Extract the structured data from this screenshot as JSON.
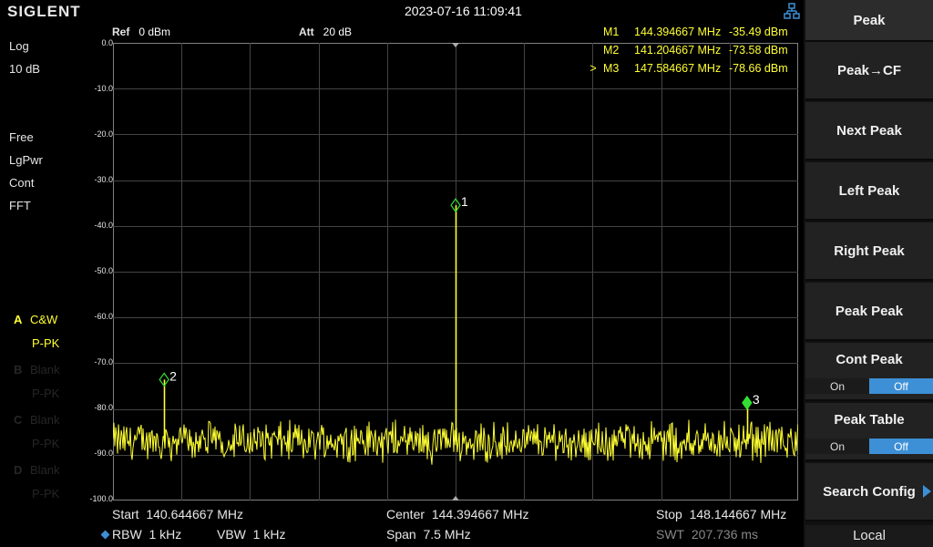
{
  "header": {
    "logo": "SIGLENT",
    "datetime": "2023-07-16 11:09:41",
    "ref_label": "Ref",
    "ref_value": "0 dBm",
    "att_label": "Att",
    "att_value": "20 dB"
  },
  "left_panel": {
    "scale_type": "Log",
    "scale_div": "10 dB",
    "sweep": "Free",
    "avg_type": "LgPwr",
    "sweep_mode": "Cont",
    "sweep_type": "FFT",
    "traces": [
      {
        "letter": "A",
        "mode": "C&W",
        "detector": "P-PK",
        "active": true
      },
      {
        "letter": "B",
        "mode": "Blank",
        "detector": "P-PK",
        "active": false
      },
      {
        "letter": "C",
        "mode": "Blank",
        "detector": "P-PK",
        "active": false
      },
      {
        "letter": "D",
        "mode": "Blank",
        "detector": "P-PK",
        "active": false
      }
    ]
  },
  "markers": [
    {
      "selected": "",
      "name": "M1",
      "freq": "144.394667 MHz",
      "level": "-35.49 dBm"
    },
    {
      "selected": "",
      "name": "M2",
      "freq": "141.204667 MHz",
      "level": "-73.58 dBm"
    },
    {
      "selected": ">",
      "name": "M3",
      "freq": "147.584667 MHz",
      "level": "-78.66 dBm"
    }
  ],
  "y_ticks": [
    "0.0",
    "-10.0",
    "-20.0",
    "-30.0",
    "-40.0",
    "-50.0",
    "-60.0",
    "-70.0",
    "-80.0",
    "-90.0",
    "-100.0"
  ],
  "footer": {
    "start_label": "Start",
    "start_value": "140.644667 MHz",
    "center_label": "Center",
    "center_value": "144.394667 MHz",
    "stop_label": "Stop",
    "stop_value": "148.144667 MHz",
    "rbw_label": "RBW",
    "rbw_value": "1 kHz",
    "vbw_label": "VBW",
    "vbw_value": "1 kHz",
    "span_label": "Span",
    "span_value": "7.5 MHz",
    "swt_label": "SWT",
    "swt_value": "207.736 ms"
  },
  "softkeys": {
    "title": "Peak",
    "peak_to_cf": "Peak→CF",
    "next_peak": "Next Peak",
    "left_peak": "Left Peak",
    "right_peak": "Right Peak",
    "peak_peak": "Peak Peak",
    "cont_peak": "Cont Peak",
    "cont_peak_on": "On",
    "cont_peak_off": "Off",
    "peak_table": "Peak Table",
    "peak_table_on": "On",
    "peak_table_off": "Off",
    "search_config": "Search Config",
    "local": "Local"
  },
  "marker_labels": [
    "1",
    "2",
    "3"
  ],
  "colors": {
    "trace": "#ffff33",
    "marker": "#33dd33",
    "accent": "#3d8fd6"
  },
  "chart_data": {
    "type": "line",
    "xlabel": "",
    "ylabel": "",
    "xlim_mhz": [
      140.644667,
      148.144667
    ],
    "ylim_dbm": [
      -100,
      0
    ],
    "noise_floor_dbm": -87,
    "peaks": [
      {
        "marker": "1",
        "freq_mhz": 144.394667,
        "level_dbm": -35.49
      },
      {
        "marker": "2",
        "freq_mhz": 141.204667,
        "level_dbm": -73.58
      },
      {
        "marker": "3",
        "freq_mhz": 147.584667,
        "level_dbm": -78.66
      }
    ]
  }
}
